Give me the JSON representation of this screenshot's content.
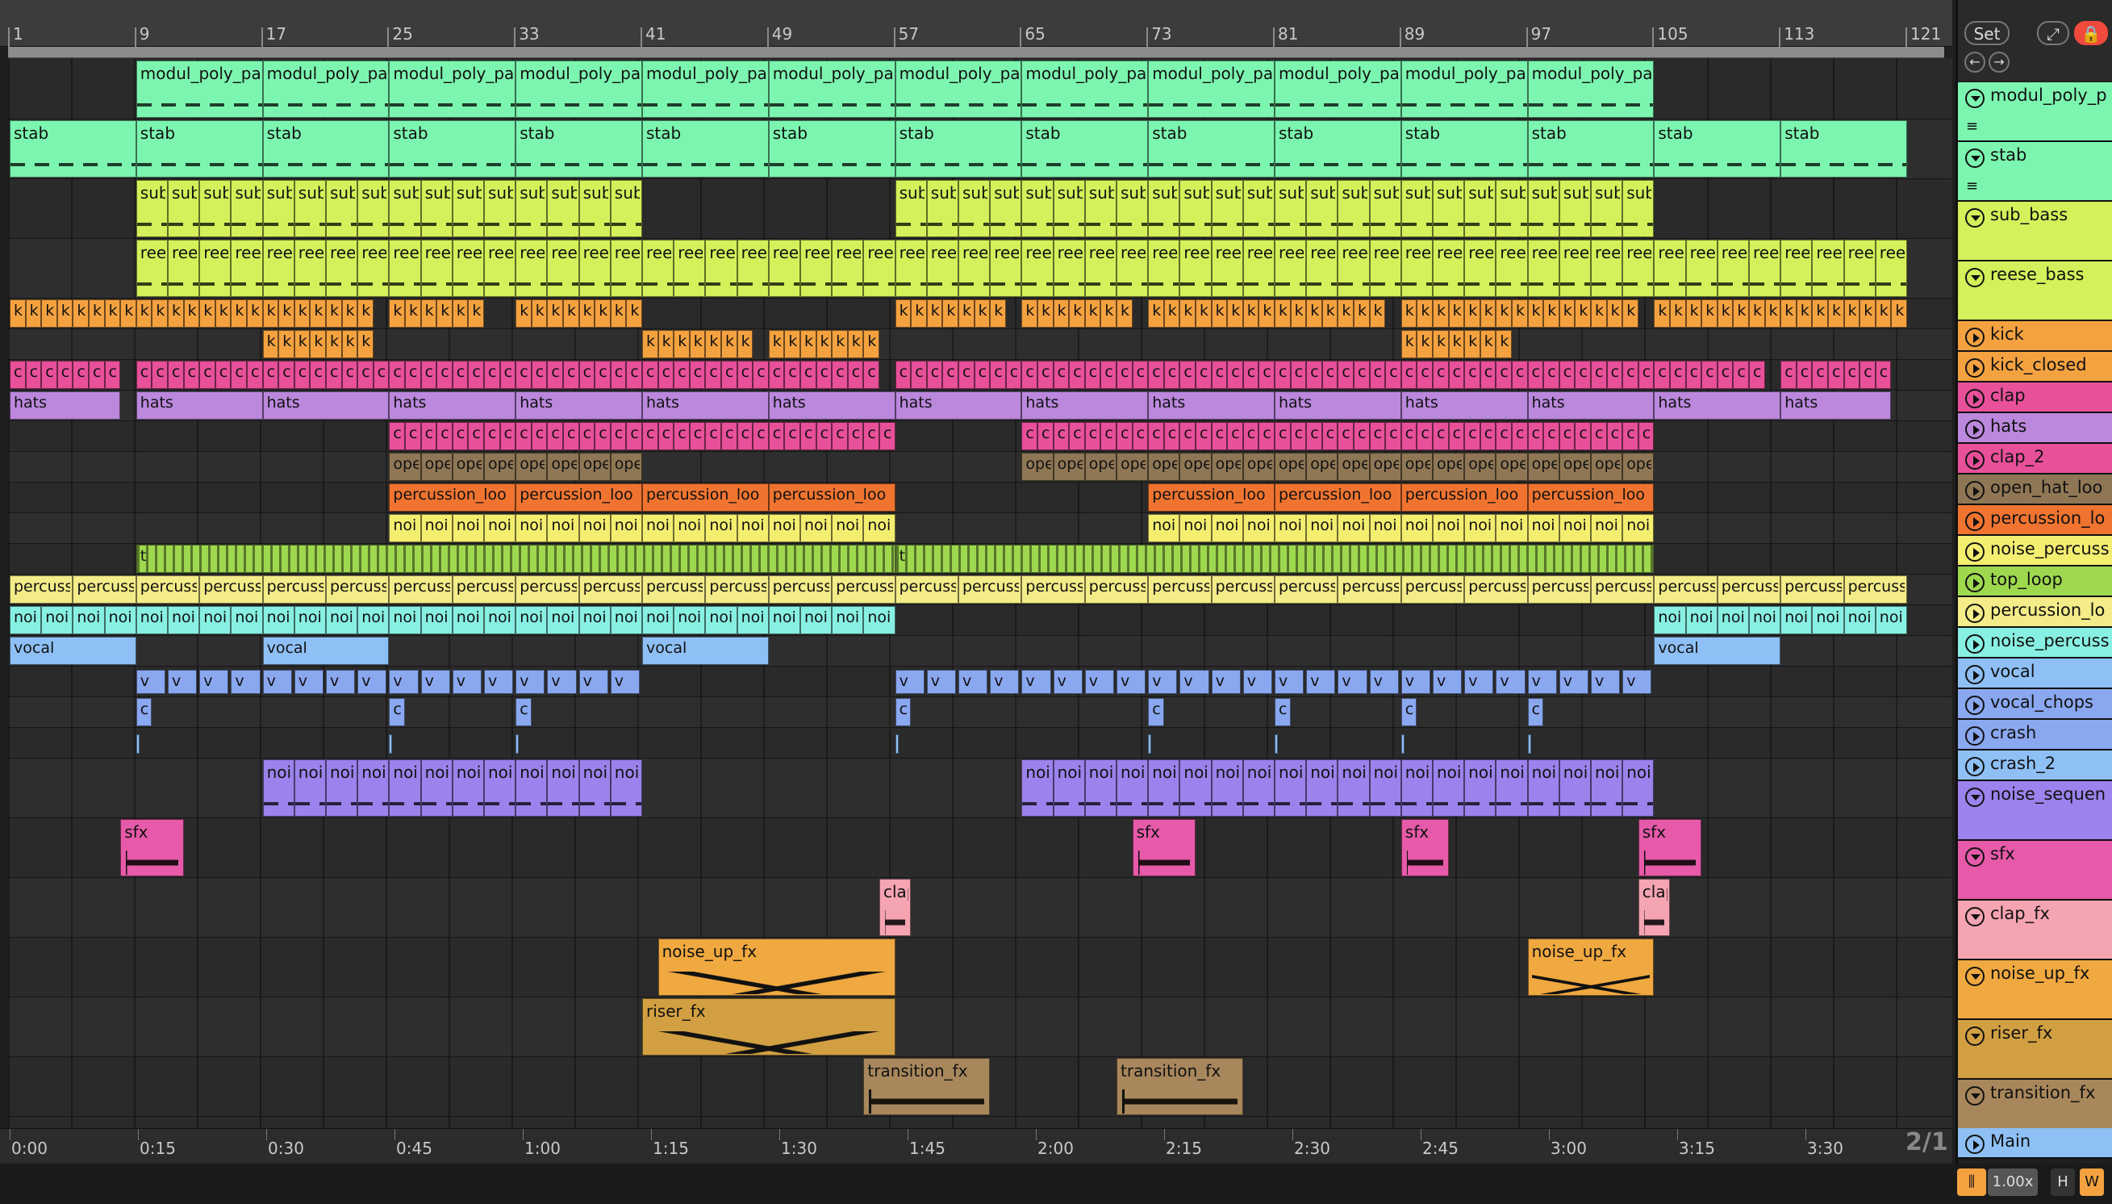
{
  "colors": {
    "mint": "#7cf5b0",
    "lime": "#d4f05a",
    "orange": "#f4a240",
    "pink": "#e8509a",
    "lavender": "#bb88dd",
    "brown": "#8f7755",
    "deeporange": "#f07430",
    "yellow": "#f4ee70",
    "green": "#9ed84e",
    "paleyellow": "#f3ec88",
    "cyan": "#88f0e2",
    "lightblue": "#8ec0f5",
    "bluechip": "#8aa8f0",
    "periwinkle": "#9b82ec",
    "magenta": "#e65aa9",
    "salmon": "#f5a4b2",
    "gold": "#f0a840",
    "mustard": "#d2a042",
    "taupe": "#a8875c"
  },
  "ruler": {
    "bars": [
      "1",
      "9",
      "17",
      "25",
      "33",
      "41",
      "49",
      "57",
      "65",
      "73",
      "81",
      "89",
      "97",
      "105",
      "113",
      "121"
    ]
  },
  "timeline": {
    "marks": [
      "0:00",
      "0:15",
      "0:30",
      "0:45",
      "1:00",
      "1:15",
      "1:30",
      "1:45",
      "2:00",
      "2:15",
      "2:30",
      "2:45",
      "3:00",
      "3:15",
      "3:30"
    ]
  },
  "head": {
    "set_label": "Set",
    "expand_icon": "expand-icon",
    "lock_icon": "lock-icon"
  },
  "tracks": [
    {
      "name": "modul_poly_p",
      "clip": "modul_poly_pa",
      "color": "mint",
      "tall": true
    },
    {
      "name": "stab",
      "clip": "stab",
      "color": "mint",
      "tall": true
    },
    {
      "name": "sub_bass",
      "clip": "sub",
      "color": "lime",
      "tall": true
    },
    {
      "name": "reese_bass",
      "clip": "ree",
      "color": "lime",
      "tall": true
    },
    {
      "name": "kick",
      "clip": "k",
      "color": "orange"
    },
    {
      "name": "kick_closed",
      "clip": "k",
      "color": "orange"
    },
    {
      "name": "clap",
      "clip": "c",
      "color": "pink"
    },
    {
      "name": "hats",
      "clip": "hats",
      "color": "lavender"
    },
    {
      "name": "clap_2",
      "clip": "c",
      "color": "pink"
    },
    {
      "name": "open_hat_loo",
      "clip": "ope",
      "color": "brown"
    },
    {
      "name": "percussion_lo",
      "clip": "percussion_loo",
      "color": "deeporange"
    },
    {
      "name": "noise_percuss",
      "clip": "noi",
      "color": "yellow"
    },
    {
      "name": "top_loop",
      "clip": "t",
      "color": "green"
    },
    {
      "name": "percussion_lo",
      "clip": "percuss",
      "color": "paleyellow"
    },
    {
      "name": "noise_percuss",
      "clip": "noi",
      "color": "cyan"
    },
    {
      "name": "vocal",
      "clip": "vocal",
      "color": "lightblue"
    },
    {
      "name": "vocal_chops",
      "clip": "v",
      "color": "bluechip"
    },
    {
      "name": "crash",
      "clip": "c",
      "color": "bluechip"
    },
    {
      "name": "crash_2",
      "clip": "",
      "color": "lightblue"
    },
    {
      "name": "noise_sequen",
      "clip": "noi",
      "color": "periwinkle",
      "tall": true
    },
    {
      "name": "sfx",
      "clip": "sfx",
      "color": "magenta",
      "tall": true
    },
    {
      "name": "clap_fx",
      "clip": "clap",
      "color": "salmon",
      "tall": true
    },
    {
      "name": "noise_up_fx",
      "clip": "noise_up_fx",
      "color": "gold",
      "tall": true
    },
    {
      "name": "riser_fx",
      "clip": "riser_fx",
      "color": "mustard",
      "tall": true
    },
    {
      "name": "transition_fx",
      "clip": "transition_fx",
      "color": "taupe",
      "tall": true
    },
    {
      "name": "Main",
      "clip": "",
      "color": "lightblue"
    }
  ],
  "page_indicator": "2/1",
  "bottom": {
    "zoom": "1.00x",
    "h": "H",
    "w": "W"
  }
}
